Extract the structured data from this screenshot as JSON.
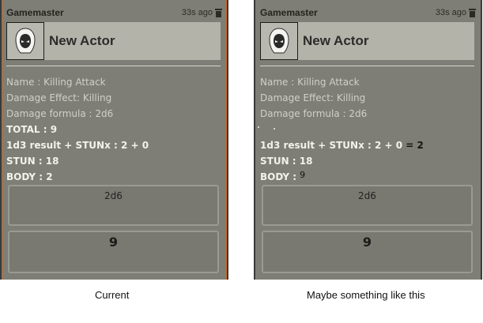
{
  "panels": [
    {
      "speaker": "Gamemaster",
      "time": "33s ago",
      "actor_name": "New Actor",
      "lines": [
        {
          "text": "Name : Killing Attack"
        },
        {
          "text": "Damage Effect: Killing"
        },
        {
          "text": "Damage formula : 2d6"
        },
        {
          "text": "TOTAL : 9"
        },
        {
          "text": "1d3 result + STUNx : 2 + 0"
        },
        {
          "text": "STUN : 18"
        },
        {
          "text": "BODY : 2"
        }
      ],
      "formula": "2d6",
      "total": "9",
      "caption": "Current"
    },
    {
      "speaker": "Gamemaster",
      "time": "33s ago",
      "actor_name": "New Actor",
      "lines": [
        {
          "text": "Name : Killing Attack"
        },
        {
          "text": "Damage Effect: Killing"
        },
        {
          "text": "Damage formula : 2d6"
        },
        {
          "text": ""
        },
        {
          "text": "1d3 result + STUNx : 2 + 0",
          "extra": " = 2"
        },
        {
          "text": "STUN : 18"
        },
        {
          "text": "BODY :",
          "extra": "9"
        }
      ],
      "formula": "2d6",
      "total": "9",
      "caption": "Maybe something like this"
    }
  ],
  "icons": {
    "trash": "trash-icon",
    "avatar": "hooded-figure-icon"
  },
  "colors": {
    "card_bg": "#7e7e76",
    "header_bar": "#b3b3aa",
    "accent_edge": "#c8661e"
  }
}
